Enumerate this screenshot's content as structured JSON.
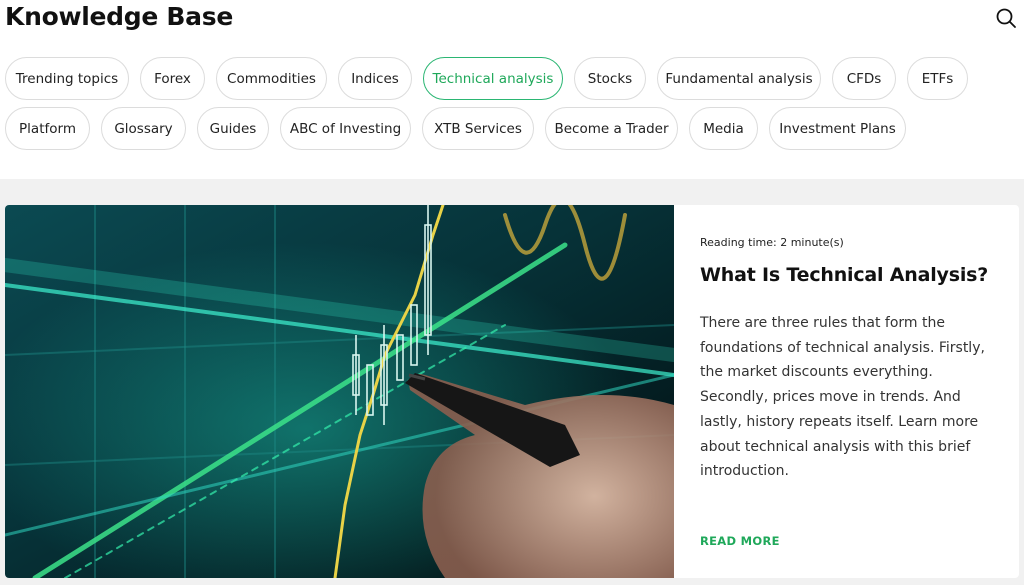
{
  "header": {
    "title": "Knowledge Base",
    "search_icon": "search-icon"
  },
  "categories": {
    "active": "Technical analysis",
    "accent_color": "#2bb673",
    "row1": [
      "Trending topics",
      "Forex",
      "Commodities",
      "Indices",
      "Technical analysis",
      "Stocks",
      "Fundamental analysis",
      "CFDs",
      "ETFs"
    ],
    "row2": [
      "Platform",
      "Glossary",
      "Guides",
      "ABC of Investing",
      "XTB Services",
      "Become a Trader",
      "Media",
      "Investment Plans"
    ]
  },
  "article": {
    "reading_time": "Reading time: 2 minute(s)",
    "title": "What Is Technical Analysis?",
    "description": "There are three rules that form the foundations of technical analysis. Firstly, the market discounts everything. Secondly, prices move in trends. And lastly, history repeats itself. Learn more about technical analysis with this brief introduction.",
    "read_more": "READ MORE",
    "image_icon": "trading-chart-photo"
  }
}
